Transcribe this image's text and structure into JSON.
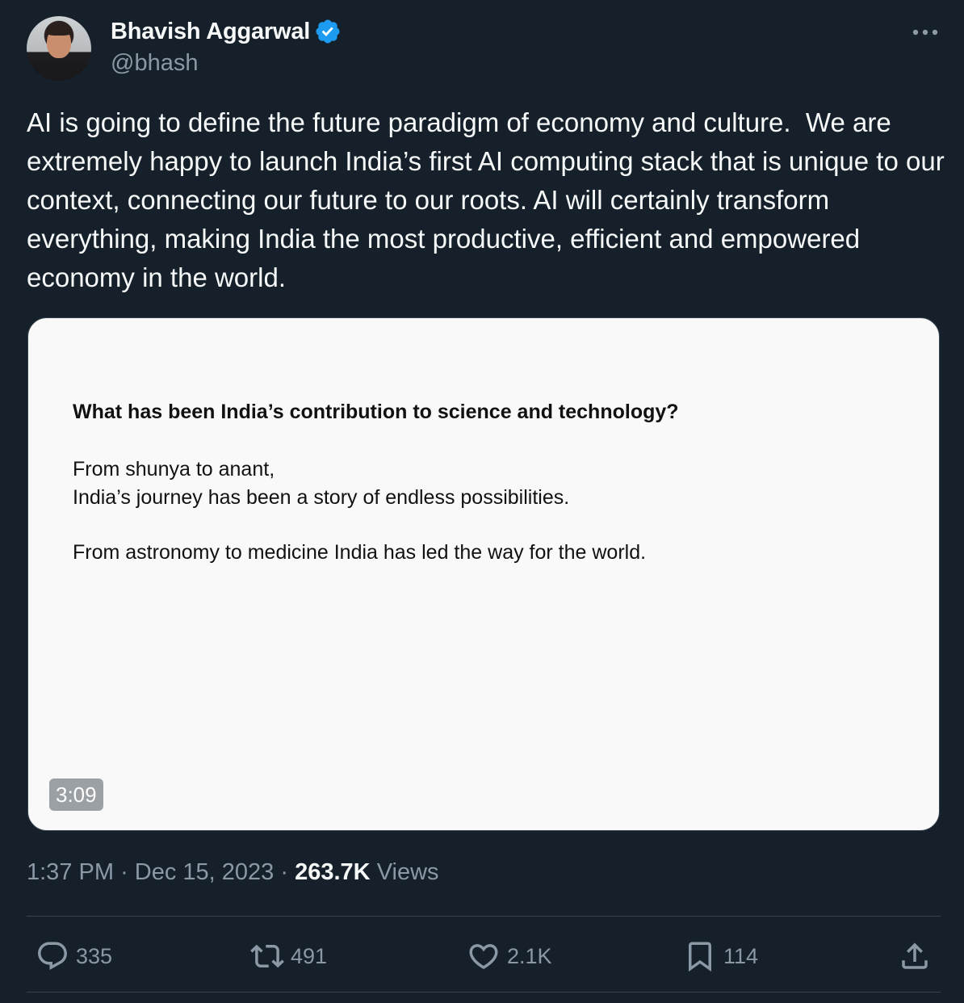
{
  "author": {
    "name": "Bhavish Aggarwal",
    "handle": "@bhash",
    "verified": true
  },
  "tweet": {
    "text": "AI is going to define the future paradigm of economy and culture.  We are extremely happy to launch India’s first AI computing stack that is unique to our context, connecting our future to our roots. AI will certainly transform everything, making India the most productive, efficient and empowered economy in the world."
  },
  "media": {
    "question": "What has been India’s contribution to science and technology?",
    "paragraph1": "From shunya to anant,\nIndia’s journey has been a story of endless possibilities.",
    "paragraph2": "From astronomy to medicine India has led the way for the world.",
    "duration": "3:09"
  },
  "meta": {
    "time": "1:37 PM",
    "separator": "·",
    "date": "Dec 15, 2023",
    "views_count": "263.7K",
    "views_label": "Views"
  },
  "actions": {
    "replies": "335",
    "reposts": "491",
    "likes": "2.1K",
    "bookmarks": "114"
  },
  "icons": {
    "verified": "verified-badge-icon",
    "more": "more-horizontal-icon",
    "reply": "reply-icon",
    "repost": "repost-icon",
    "like": "heart-icon",
    "bookmark": "bookmark-icon",
    "share": "share-icon"
  },
  "colors": {
    "background": "#15202b",
    "text": "#f7f9f9",
    "secondary_text": "#8b98a5",
    "verified": "#1d9bf0",
    "border": "#38444d"
  }
}
